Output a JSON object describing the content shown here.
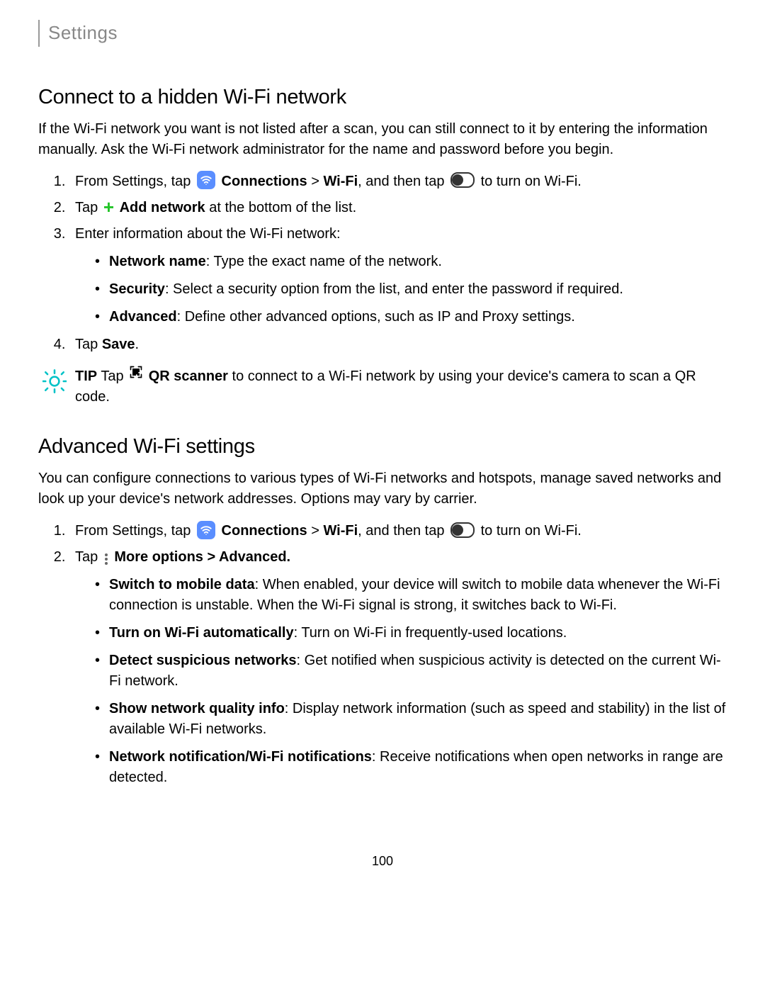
{
  "header": "Settings",
  "section1": {
    "title": "Connect to a hidden Wi-Fi network",
    "intro": "If the Wi-Fi network you want is not listed after a scan, you can still connect to it by entering the information manually. Ask the Wi-Fi network administrator for the name and password before you begin.",
    "step1_a": "From Settings, tap ",
    "step1_conn": "Connections",
    "step1_gt": " > ",
    "step1_wifi": "Wi-Fi",
    "step1_b": ", and then tap ",
    "step1_c": " to turn on Wi-Fi.",
    "step2_a": "Tap ",
    "step2_add": "Add network",
    "step2_b": " at the bottom of the list.",
    "step3": "Enter information about the Wi-Fi network:",
    "sub_net_label": "Network name",
    "sub_net_text": ": Type the exact name of the network.",
    "sub_sec_label": "Security",
    "sub_sec_text": ": Select a security option from the list, and enter the password if required.",
    "sub_adv_label": "Advanced",
    "sub_adv_text": ": Define other advanced options, such as IP and Proxy settings.",
    "step4_a": "Tap ",
    "step4_save": "Save",
    "step4_b": ".",
    "tip_label": "TIP",
    "tip_a": "  Tap ",
    "tip_qr": "QR scanner",
    "tip_b": " to connect to a Wi-Fi network by using your device's camera to scan a QR code."
  },
  "section2": {
    "title": "Advanced Wi-Fi settings",
    "intro": "You can configure connections to various types of Wi-Fi networks and hotspots, manage saved networks and look up your device's network addresses. Options may vary by carrier.",
    "step1_a": "From Settings, tap ",
    "step1_conn": "Connections",
    "step1_gt": " > ",
    "step1_wifi": "Wi-Fi",
    "step1_b": ", and then tap ",
    "step1_c": " to turn on Wi-Fi.",
    "step2_a": "Tap ",
    "step2_more": "More options > Advanced.",
    "sub_mob_label": "Switch to mobile data",
    "sub_mob_text": ": When enabled, your device will switch to mobile data whenever the Wi-Fi connection is unstable. When the Wi-Fi signal is strong, it switches back to Wi-Fi.",
    "sub_auto_label": "Turn on Wi-Fi automatically",
    "sub_auto_text": ": Turn on Wi-Fi in frequently-used locations.",
    "sub_susp_label": "Detect suspicious networks",
    "sub_susp_text": ": Get notified when suspicious activity is detected on the current Wi-Fi network.",
    "sub_qual_label": "Show network quality info",
    "sub_qual_text": ": Display network information (such as speed and stability) in the list of available Wi-Fi networks.",
    "sub_notif_label": "Network notification/Wi-Fi notifications",
    "sub_notif_text": ": Receive notifications when open networks in range are detected."
  },
  "page_number": "100"
}
